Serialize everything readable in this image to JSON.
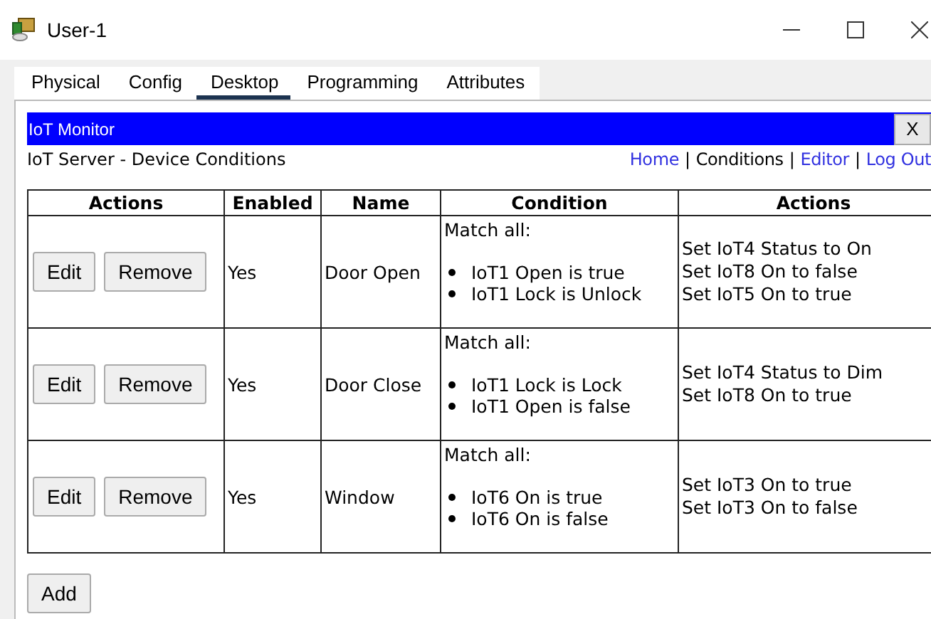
{
  "window": {
    "title": "User-1"
  },
  "tabs": [
    {
      "label": "Physical",
      "selected": false
    },
    {
      "label": "Config",
      "selected": false
    },
    {
      "label": "Desktop",
      "selected": true
    },
    {
      "label": "Programming",
      "selected": false
    },
    {
      "label": "Attributes",
      "selected": false
    }
  ],
  "app_bar": {
    "title": "IoT Monitor",
    "close": "X"
  },
  "header": {
    "title": "IoT Server - Device Conditions",
    "nav": [
      {
        "label": "Home",
        "kind": "link"
      },
      {
        "label": "|",
        "kind": "separator"
      },
      {
        "label": "Conditions",
        "kind": "current"
      },
      {
        "label": "|",
        "kind": "separator"
      },
      {
        "label": "Editor",
        "kind": "link"
      },
      {
        "label": "|",
        "kind": "separator"
      },
      {
        "label": "Log Out",
        "kind": "link"
      }
    ]
  },
  "table": {
    "columns": [
      "Actions",
      "Enabled",
      "Name",
      "Condition",
      "Actions"
    ],
    "rows": [
      {
        "buttons": [
          "Edit",
          "Remove"
        ],
        "enabled": "Yes",
        "name": "Door Open",
        "match": "Match all:",
        "conditions": [
          "IoT1 Open is true",
          "IoT1 Lock is Unlock"
        ],
        "actions": [
          "Set IoT4 Status to On",
          "Set IoT8 On to false",
          "Set IoT5 On to true"
        ]
      },
      {
        "buttons": [
          "Edit",
          "Remove"
        ],
        "enabled": "Yes",
        "name": "Door Close",
        "match": "Match all:",
        "conditions": [
          "IoT1 Lock is Lock",
          "IoT1 Open is false"
        ],
        "actions": [
          "Set IoT4 Status to Dim",
          "Set IoT8 On to true"
        ]
      },
      {
        "buttons": [
          "Edit",
          "Remove"
        ],
        "enabled": "Yes",
        "name": "Window",
        "match": "Match all:",
        "conditions": [
          "IoT6 On is true",
          "IoT6 On is false"
        ],
        "actions": [
          "Set IoT3 On to true",
          "Set IoT3 On to false"
        ]
      }
    ]
  },
  "add_button": "Add"
}
